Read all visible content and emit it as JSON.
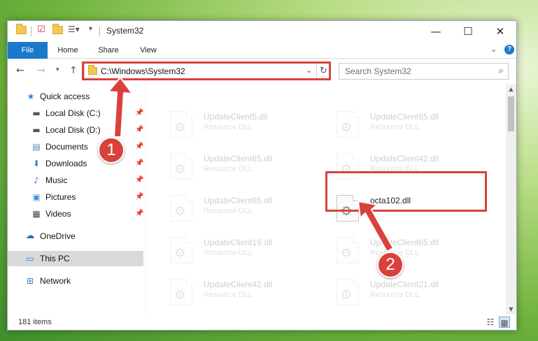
{
  "window": {
    "title": "System32",
    "controls": {
      "minimize": "—",
      "maximize": "☐",
      "close": "✕"
    }
  },
  "ribbon": {
    "tabs": [
      "File",
      "Home",
      "Share",
      "View"
    ],
    "expand_icon": "chevron-down-icon",
    "help_label": "?"
  },
  "address_bar": {
    "path": "C:\\Windows\\System32",
    "dropdown_icon": "chevron-down-icon",
    "refresh_icon": "refresh-icon"
  },
  "search": {
    "placeholder": "Search System32"
  },
  "nav_pane": {
    "quick_access": "Quick access",
    "items": [
      {
        "label": "Local Disk (C:)",
        "icon": "drive-icon",
        "pinned": true
      },
      {
        "label": "Local Disk (D:)",
        "icon": "drive-icon",
        "pinned": true
      },
      {
        "label": "Documents",
        "icon": "documents-icon",
        "pinned": true
      },
      {
        "label": "Downloads",
        "icon": "downloads-icon",
        "pinned": true
      },
      {
        "label": "Music",
        "icon": "music-icon",
        "pinned": true
      },
      {
        "label": "Pictures",
        "icon": "pictures-icon",
        "pinned": true
      },
      {
        "label": "Videos",
        "icon": "videos-icon",
        "pinned": true
      }
    ],
    "onedrive": "OneDrive",
    "this_pc": "This PC",
    "network": "Network",
    "selected": "This PC"
  },
  "files": {
    "left_column": [
      {
        "name": "UpdateClient5.dll",
        "type": "Resource DLL"
      },
      {
        "name": "UpdateClient65.dll",
        "type": "Resource DLL"
      },
      {
        "name": "UpdateClient65.dll",
        "type": "Resource DLL"
      },
      {
        "name": "UpdateClient19.dll",
        "type": "Resource DLL"
      },
      {
        "name": "UpdateClient42.dll",
        "type": "Resource DLL"
      }
    ],
    "right_column": [
      {
        "name": "UpdateClient65.dll",
        "type": "Resource DLL"
      },
      {
        "name": "UpdateClient42.dll",
        "type": "Resource DLL"
      },
      {
        "name": "octa102.dll",
        "type": ""
      },
      {
        "name": "UpdateClient65.dll",
        "type": "Resource DLL"
      },
      {
        "name": "UpdateClient21.dll",
        "type": "Resource DLL"
      }
    ],
    "highlighted": "octa102.dll"
  },
  "status_bar": {
    "item_count": "181 items"
  },
  "annotations": {
    "step1": "1",
    "step2": "2",
    "color": "#d9423b"
  }
}
